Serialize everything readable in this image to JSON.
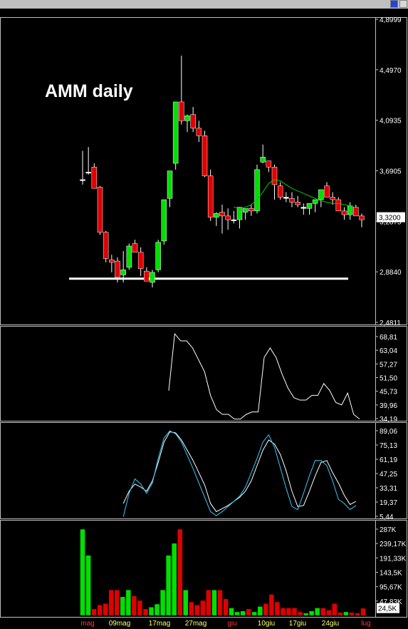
{
  "colors": {
    "up": "#00e000",
    "down": "#e00000",
    "ma": "#00cc00",
    "osc1": "#ffffff",
    "osc2a": "#ffffff",
    "osc2b": "#33ccff",
    "last_box": "#ffffff",
    "support": "#ffffff",
    "month_label": "#ff3333",
    "date_label": "#ffff66"
  },
  "chart_data": [
    {
      "type": "candlestick",
      "title": "AMM daily",
      "y_ticks": [
        "4,8999",
        "4,4970",
        "4,0935",
        "3,6905",
        "3,2875",
        "2,8840",
        "2,4811"
      ],
      "ylim": [
        2.4811,
        4.8999
      ],
      "last_price_label": "3,3200",
      "x_labels": [
        {
          "text": "mag",
          "type": "month"
        },
        {
          "text": "09mag",
          "type": "date"
        },
        {
          "text": "17mag",
          "type": "date"
        },
        {
          "text": "27mag",
          "type": "date"
        },
        {
          "text": "giu",
          "type": "month"
        },
        {
          "text": "10giu",
          "type": "date"
        },
        {
          "text": "17giu",
          "type": "date"
        },
        {
          "text": "24giu",
          "type": "date"
        },
        {
          "text": "lug",
          "type": "month"
        }
      ],
      "support_level": 2.83,
      "candles": [
        [
          3.62,
          3.85,
          3.58,
          3.62
        ],
        [
          3.68,
          3.88,
          3.66,
          3.68
        ],
        [
          3.72,
          3.75,
          3.56,
          3.55
        ],
        [
          3.56,
          3.57,
          3.18,
          3.2
        ],
        [
          3.2,
          3.21,
          2.96,
          2.99
        ],
        [
          2.98,
          3.02,
          2.88,
          2.96
        ],
        [
          2.97,
          3.0,
          2.8,
          2.84
        ],
        [
          2.86,
          3.05,
          2.8,
          2.9
        ],
        [
          2.92,
          3.11,
          2.9,
          3.09
        ],
        [
          3.11,
          3.14,
          3.04,
          3.04
        ],
        [
          3.04,
          3.08,
          2.85,
          2.91
        ],
        [
          2.89,
          2.92,
          2.82,
          2.81
        ],
        [
          2.8,
          2.9,
          2.76,
          2.88
        ],
        [
          2.9,
          3.14,
          2.88,
          3.12
        ],
        [
          3.13,
          3.41,
          3.1,
          3.46
        ],
        [
          3.47,
          3.66,
          3.4,
          3.69
        ],
        [
          3.75,
          4.24,
          3.7,
          4.24
        ],
        [
          4.24,
          4.61,
          4.06,
          4.09
        ],
        [
          4.09,
          4.14,
          4.0,
          4.13
        ],
        [
          4.14,
          4.2,
          4.0,
          4.03
        ],
        [
          4.03,
          4.09,
          3.92,
          3.97
        ],
        [
          3.97,
          4.01,
          3.64,
          3.65
        ],
        [
          3.65,
          3.7,
          3.29,
          3.32
        ],
        [
          3.32,
          3.36,
          3.25,
          3.35
        ],
        [
          3.36,
          3.42,
          3.19,
          3.33
        ],
        [
          3.33,
          3.39,
          3.22,
          3.3
        ],
        [
          3.3,
          3.37,
          3.27,
          3.3
        ],
        [
          3.3,
          3.4,
          3.23,
          3.4
        ],
        [
          3.36,
          3.39,
          3.3,
          3.39
        ],
        [
          3.39,
          3.42,
          3.33,
          3.37
        ],
        [
          3.37,
          3.74,
          3.35,
          3.7
        ],
        [
          3.76,
          3.9,
          3.75,
          3.8
        ],
        [
          3.77,
          3.77,
          3.68,
          3.72
        ],
        [
          3.72,
          3.74,
          3.46,
          3.58
        ],
        [
          3.57,
          3.6,
          3.46,
          3.48
        ],
        [
          3.48,
          3.52,
          3.44,
          3.47
        ],
        [
          3.47,
          3.52,
          3.4,
          3.44
        ],
        [
          3.44,
          3.49,
          3.4,
          3.42
        ],
        [
          3.4,
          3.43,
          3.34,
          3.39
        ],
        [
          3.39,
          3.43,
          3.34,
          3.43
        ],
        [
          3.43,
          3.46,
          3.36,
          3.46
        ],
        [
          3.46,
          3.48,
          3.4,
          3.54
        ],
        [
          3.57,
          3.6,
          3.5,
          3.48
        ],
        [
          3.48,
          3.52,
          3.42,
          3.46
        ],
        [
          3.46,
          3.48,
          3.37,
          3.37
        ],
        [
          3.37,
          3.4,
          3.3,
          3.34
        ],
        [
          3.34,
          3.44,
          3.3,
          3.41
        ],
        [
          3.4,
          3.42,
          3.33,
          3.33
        ],
        [
          3.33,
          3.35,
          3.24,
          3.3
        ]
      ],
      "moving_average": [
        3.4,
        3.39,
        3.4,
        3.42,
        3.46,
        3.52,
        3.59,
        3.62,
        3.61,
        3.58,
        3.55,
        3.53,
        3.51,
        3.49,
        3.47,
        3.45,
        3.44,
        3.43,
        3.43,
        3.42,
        3.41
      ]
    },
    {
      "type": "line",
      "y_ticks": [
        "68,81",
        "63,04",
        "57,27",
        "51,50",
        "45,73",
        "39,96",
        "34,19"
      ],
      "ylim": [
        34.19,
        68.81
      ],
      "series_values": [
        46,
        70,
        67,
        67,
        64,
        59,
        54,
        44,
        38,
        36,
        36,
        34,
        34,
        36,
        37,
        37,
        60,
        64,
        60,
        53,
        47,
        43,
        42,
        42,
        44,
        44,
        49,
        46,
        41,
        40,
        45,
        36,
        34
      ]
    },
    {
      "type": "line",
      "y_ticks": [
        "89,06",
        "75,13",
        "61,19",
        "47,25",
        "33,31",
        "19,37",
        "5,44"
      ],
      "ylim": [
        5.44,
        89.06
      ],
      "series": [
        {
          "values": [
            null,
            null,
            null,
            null,
            null,
            null,
            null,
            18,
            30,
            37,
            34,
            30,
            40,
            58,
            78,
            88,
            87,
            80,
            70,
            60,
            48,
            36,
            18,
            10,
            13,
            16,
            20,
            24,
            30,
            40,
            55,
            70,
            80,
            76,
            66,
            50,
            30,
            15,
            16,
            30,
            45,
            58,
            60,
            48,
            38,
            26,
            17,
            20
          ]
        },
        {
          "values": [
            null,
            null,
            null,
            null,
            null,
            null,
            null,
            5,
            28,
            42,
            37,
            28,
            38,
            62,
            82,
            89,
            86,
            78,
            65,
            52,
            38,
            24,
            10,
            6,
            10,
            15,
            20,
            25,
            34,
            48,
            62,
            78,
            85,
            73,
            53,
            33,
            15,
            12,
            28,
            45,
            60,
            60,
            55,
            40,
            22,
            18,
            12,
            16
          ]
        }
      ]
    },
    {
      "type": "bar",
      "y_ticks": [
        "287K",
        "239,17K",
        "191,33K",
        "143,5K",
        "95,67K",
        "47,83K"
      ],
      "ylim": [
        0,
        287
      ],
      "last_value_label": "24,5K",
      "values": [
        287,
        200,
        22,
        35,
        40,
        85,
        85,
        62,
        85,
        65,
        50,
        22,
        28,
        38,
        85,
        200,
        240,
        287,
        85,
        45,
        35,
        50,
        85,
        85,
        85,
        55,
        25,
        12,
        15,
        22,
        12,
        30,
        40,
        70,
        45,
        25,
        25,
        25,
        12,
        8,
        15,
        25,
        25,
        18,
        40,
        10,
        12,
        10,
        8,
        24
      ]
    }
  ]
}
